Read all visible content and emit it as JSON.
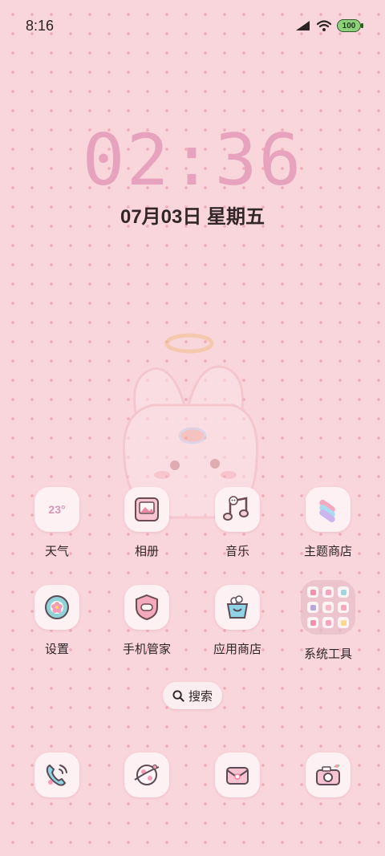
{
  "status_bar": {
    "time": "8:16",
    "battery_level": "100",
    "battery_color": "#8fd07c"
  },
  "lock_clock": {
    "time": "02:36",
    "date": "07月03日 星期五",
    "color": "#e7a3be"
  },
  "weather_widget": {
    "temp": "23°"
  },
  "apps": [
    {
      "label": "天气",
      "icon": "weather-icon"
    },
    {
      "label": "相册",
      "icon": "gallery-icon"
    },
    {
      "label": "音乐",
      "icon": "music-icon"
    },
    {
      "label": "主题商店",
      "icon": "theme-store-icon"
    },
    {
      "label": "设置",
      "icon": "settings-icon"
    },
    {
      "label": "手机管家",
      "icon": "phone-manager-icon"
    },
    {
      "label": "应用商店",
      "icon": "app-store-icon"
    },
    {
      "label": "系统工具",
      "icon": "system-tools-folder-icon"
    }
  ],
  "search": {
    "label": "搜索",
    "icon": "search-icon"
  },
  "dock": [
    {
      "icon": "phone-icon"
    },
    {
      "icon": "browser-icon"
    },
    {
      "icon": "messages-icon"
    },
    {
      "icon": "camera-icon"
    }
  ],
  "theme": {
    "background": "#f9d6dc",
    "dot": "#f3aebb",
    "tile": "#fdf1f3"
  }
}
